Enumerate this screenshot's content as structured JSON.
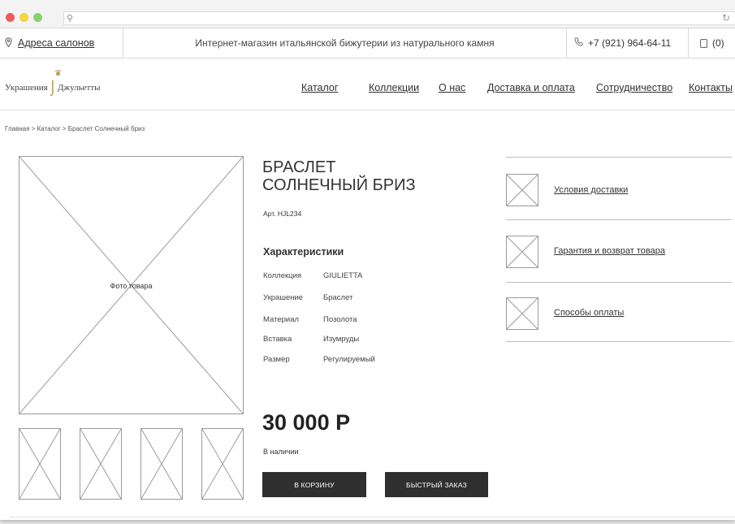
{
  "browser": {
    "search_glyph": "⚲",
    "reload_glyph": "↻"
  },
  "topbar": {
    "stores_link": "Адреса салонов",
    "tagline": "Интернет-магазин итальянской бижутерии из натурального камня",
    "phone": "+7 (921) 964-64-11",
    "cart_count": "(0)"
  },
  "logo": {
    "left": "Украшения",
    "right": "Джульетты"
  },
  "nav": {
    "items": [
      "Каталог",
      "Коллекции",
      "О нас",
      "Доставка и оплата",
      "Сотрудничество",
      "Контакты"
    ]
  },
  "breadcrumb": "Главная > Каталог > Браслет Солнечный бриз",
  "product": {
    "photo_label": "Фото товара",
    "title_line1": "БРАСЛЕТ",
    "title_line2": "СОЛНЕЧНЫЙ БРИЗ",
    "sku": "Арт. HJL234",
    "specs_heading": "Характеристики",
    "specs": [
      {
        "key": "Коллекция",
        "value": "GIULIETTA"
      },
      {
        "key": "Украшение",
        "value": "Браслет"
      },
      {
        "key": "Материал",
        "value": "Позолота"
      },
      {
        "key": "Вставка",
        "value": "Изумруды"
      },
      {
        "key": "Размер",
        "value": "Регулируемый"
      }
    ],
    "price": "30 000 Р",
    "availability": "В наличии",
    "add_to_cart": "В КОРЗИНУ",
    "quick_order": "БЫСТРЫЙ ЗАКАЗ"
  },
  "info_links": [
    "Условия доставки",
    "Гарантия и возврат товара",
    "Способы оплаты"
  ],
  "icons": {
    "pin": "location-pin-icon",
    "phone": "phone-icon",
    "cart": "shopping-bag-icon",
    "crown": "crown-icon"
  },
  "colors": {
    "button_bg": "#2f2f2f",
    "logo_gold": "#a0822c",
    "close_dot": "#ed5a5f",
    "minimize_dot": "#f3d83e",
    "maximize_dot": "#85d36b"
  }
}
